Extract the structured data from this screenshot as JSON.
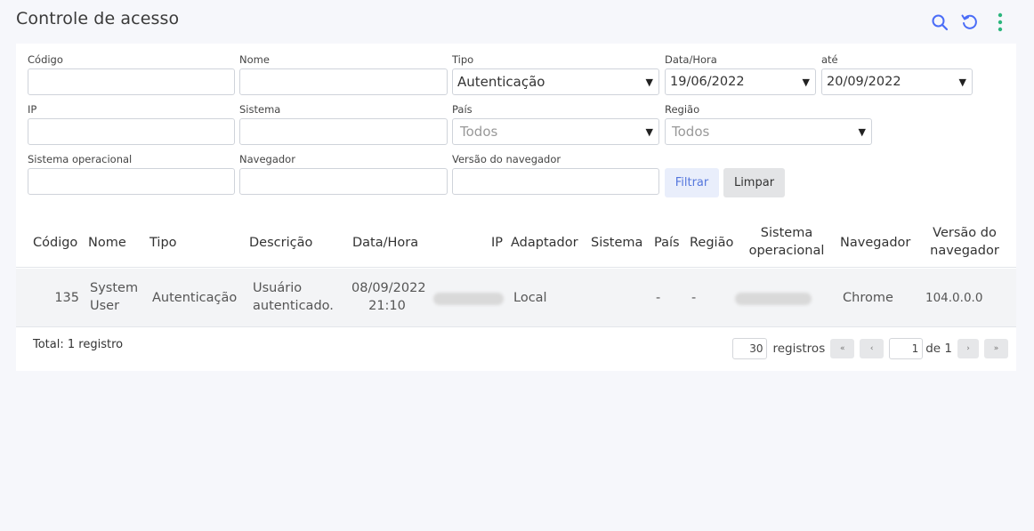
{
  "header": {
    "title": "Controle de acesso",
    "icons": {
      "search": "search-icon",
      "refresh": "refresh-icon",
      "more": "more-vertical-icon"
    },
    "icon_colors": {
      "search": "#4a6cf7",
      "refresh": "#4a6cf7",
      "more": "#2cb67d"
    }
  },
  "filters": {
    "codigo": {
      "label": "Código",
      "value": ""
    },
    "nome": {
      "label": "Nome",
      "value": ""
    },
    "tipo": {
      "label": "Tipo",
      "value": "Autenticação"
    },
    "data_hora": {
      "label": "Data/Hora",
      "value": "19/06/2022"
    },
    "ate": {
      "label": "até",
      "value": "20/09/2022"
    },
    "ip": {
      "label": "IP",
      "value": ""
    },
    "sistema": {
      "label": "Sistema",
      "value": ""
    },
    "pais": {
      "label": "País",
      "value": "Todos"
    },
    "regiao": {
      "label": "Região",
      "value": "Todos"
    },
    "sistema_operacional": {
      "label": "Sistema operacional",
      "value": ""
    },
    "navegador": {
      "label": "Navegador",
      "value": ""
    },
    "versao_navegador": {
      "label": "Versão do navegador",
      "value": ""
    },
    "filter_button": "Filtrar",
    "clear_button": "Limpar"
  },
  "table": {
    "columns": {
      "codigo": "Código",
      "nome": "Nome",
      "tipo": "Tipo",
      "descricao": "Descrição",
      "data_hora": "Data/Hora",
      "ip": "IP",
      "adaptador": "Adaptador",
      "sistema": "Sistema",
      "pais": "País",
      "regiao": "Região",
      "so_line1": "Sistema",
      "so_line2": "operacional",
      "navegador": "Navegador",
      "versao_line1": "Versão do",
      "versao_line2": "navegador"
    },
    "rows": [
      {
        "codigo": "135",
        "nome_line1": "System",
        "nome_line2": "User",
        "tipo": "Autenticação",
        "descricao_line1": "Usuário",
        "descricao_line2": "autenticado.",
        "data_line1": "08/09/2022",
        "data_line2": "21:10",
        "adaptador": "Local",
        "sistema": "",
        "pais": "-",
        "regiao": "-",
        "navegador": "Chrome",
        "versao": "104.0.0.0"
      }
    ]
  },
  "footer": {
    "total": "Total: 1 registro",
    "page_size": "30",
    "registros_label": "registros",
    "current_page": "1",
    "of_label": "de 1",
    "first": "«",
    "prev": "‹",
    "next": "›",
    "last": "»"
  }
}
